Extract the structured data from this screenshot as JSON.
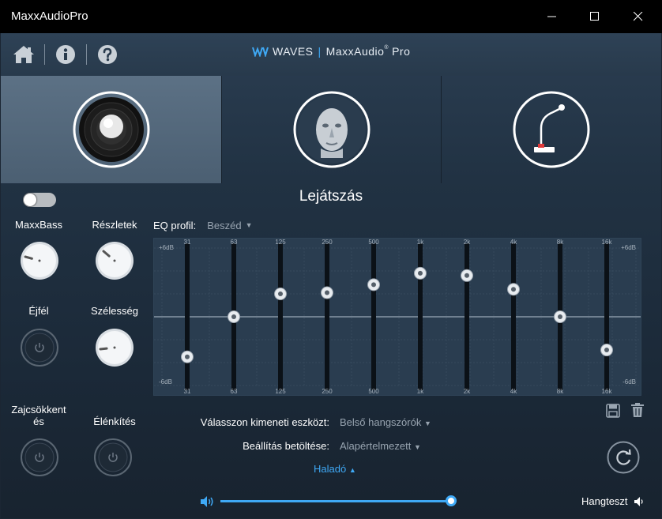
{
  "window": {
    "title": "MaxxAudioPro"
  },
  "toolbar": {
    "brand_waves": "WAVES",
    "brand_sep": "|",
    "brand_name": "MaxxAudio",
    "brand_reg": "®",
    "brand_pro": "Pro"
  },
  "tabs": [
    {
      "id": "speaker",
      "icon": "speaker-icon",
      "active": true
    },
    {
      "id": "headphones",
      "icon": "head-icon",
      "active": false
    },
    {
      "id": "microphone",
      "icon": "microphone-icon",
      "active": false
    }
  ],
  "section_title": "Lejátszás",
  "knobs": {
    "maxxbass": {
      "label": "MaxxBass"
    },
    "reszletek": {
      "label": "Részletek"
    },
    "ejfel": {
      "label": "Éjfél"
    },
    "szelesseg": {
      "label": "Szélesség"
    },
    "zajcsokkentes": {
      "label": "Zajcsökkent\nés"
    },
    "elenkites": {
      "label": "Élénkítés"
    }
  },
  "eq": {
    "profile_label": "EQ profil:",
    "profile_value": "Beszéd",
    "db_top": "+6dB",
    "db_bottom": "-6dB",
    "bands": [
      {
        "freq": "31",
        "gain": -3.5
      },
      {
        "freq": "63",
        "gain": 0
      },
      {
        "freq": "125",
        "gain": 2.0
      },
      {
        "freq": "250",
        "gain": 2.1
      },
      {
        "freq": "500",
        "gain": 2.8
      },
      {
        "freq": "1k",
        "gain": 3.8
      },
      {
        "freq": "2k",
        "gain": 3.6
      },
      {
        "freq": "4k",
        "gain": 2.4
      },
      {
        "freq": "8k",
        "gain": 0
      },
      {
        "freq": "16k",
        "gain": -2.9
      }
    ]
  },
  "output": {
    "device_label": "Válasszon kimeneti eszközt:",
    "device_value": "Belső hangszórók",
    "preset_label": "Beállítás betöltése:",
    "preset_value": "Alapértelmezett"
  },
  "advanced_label": "Haladó",
  "volume": {
    "level": 1.0
  },
  "test_label": "Hangteszt",
  "colors": {
    "accent": "#3fa9f5",
    "titlebar": "#000000"
  }
}
